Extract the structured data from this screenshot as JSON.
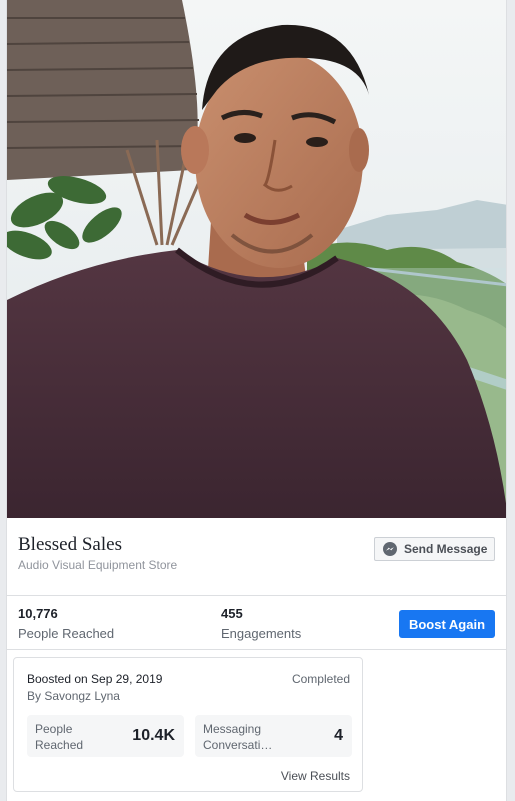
{
  "page": {
    "name": "Blessed Sales",
    "category": "Audio Visual Equipment Store",
    "send_message_label": "Send Message"
  },
  "stats": {
    "people_reached_value": "10,776",
    "people_reached_label": "People Reached",
    "engagements_value": "455",
    "engagements_label": "Engagements",
    "boost_again_label": "Boost Again"
  },
  "boost": {
    "boosted_on": "Boosted on Sep 29, 2019",
    "boosted_by": "By Savongz Lyna",
    "status": "Completed",
    "metrics": [
      {
        "label_line1": "People",
        "label_line2": "Reached",
        "value": "10.4K"
      },
      {
        "label_line1": "Messaging",
        "label_line2": "Conversati…",
        "value": "4"
      }
    ],
    "view_results_label": "View Results"
  },
  "colors": {
    "accent": "#1877f2",
    "sweater": "#4a2e37",
    "border": "#dddfe2"
  },
  "icons": {
    "send_message": "messenger-icon"
  }
}
